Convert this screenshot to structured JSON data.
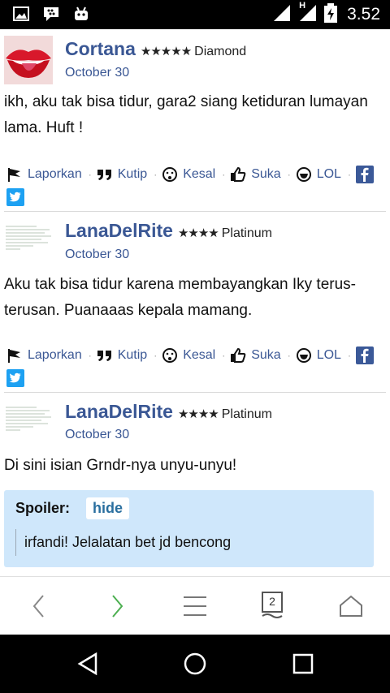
{
  "status_bar": {
    "time": "3.52",
    "network_letter": "H",
    "icons": [
      "image-icon",
      "bbm-icon",
      "android-icon",
      "signal-icon",
      "signal-h-icon",
      "battery-charging-icon"
    ]
  },
  "posts": [
    {
      "username": "Cortana",
      "stars": "★★★★★",
      "rank": "Diamond",
      "date": "October 30",
      "body": "ikh, aku tak bisa tidur, gara2 siang ketiduran lumayan lama. Huft !",
      "actions": {
        "report": "Laporkan",
        "quote": "Kutip",
        "annoyed": "Kesal",
        "like": "Suka",
        "lol": "LOL"
      }
    },
    {
      "username": "LanaDelRite",
      "stars": "★★★★",
      "rank": "Platinum",
      "date": "October 30",
      "body": "Aku tak bisa tidur karena membayangkan Iky terus-terusan. Puanaaas kepala mamang.",
      "actions": {
        "report": "Laporkan",
        "quote": "Kutip",
        "annoyed": "Kesal",
        "like": "Suka",
        "lol": "LOL"
      }
    },
    {
      "username": "LanaDelRite",
      "stars": "★★★★",
      "rank": "Platinum",
      "date": "October 30",
      "body": "Di sini isian Grndr-nya unyu-unyu!",
      "spoiler": {
        "label": "Spoiler:",
        "button": "hide",
        "content": "irfandi! Jelalatan bet jd bencong"
      }
    }
  ],
  "toolbar": {
    "tab_count": "2",
    "icons": [
      "back-icon",
      "forward-icon",
      "menu-icon",
      "tabs-icon",
      "home-icon"
    ]
  },
  "colors": {
    "link": "#3a5794",
    "spoiler_bg": "#cfe7fb",
    "forward_active": "#4caf50",
    "facebook": "#3b5998",
    "twitter": "#1da1f2"
  }
}
